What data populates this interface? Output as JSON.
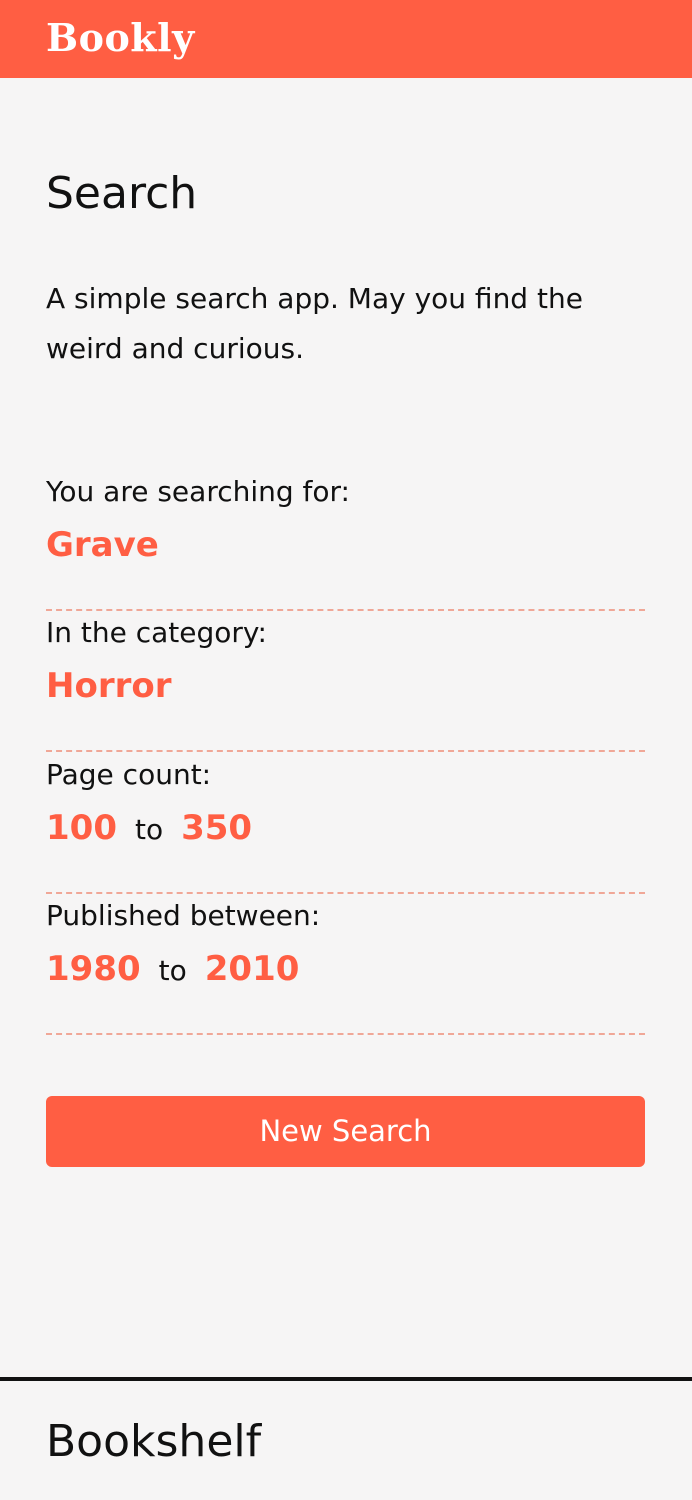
{
  "header": {
    "logo": "Bookly"
  },
  "search": {
    "title": "Search",
    "intro": "A simple search app. May you find the weird and curious.",
    "query_label": "You are searching for:",
    "query_value": "Grave",
    "category_label": "In the category:",
    "category_value": "Horror",
    "pages_label": "Page count:",
    "pages_min": "100",
    "pages_max": "350",
    "pages_sep": "to",
    "published_label": "Published between:",
    "published_min": "1980",
    "published_max": "2010",
    "published_sep": "to",
    "new_search_label": "New Search"
  },
  "bookshelf": {
    "title": "Bookshelf"
  },
  "colors": {
    "accent": "#ff5e43",
    "background": "#f6f5f5",
    "text": "#111111",
    "divider_dashed": "#f0a797"
  }
}
